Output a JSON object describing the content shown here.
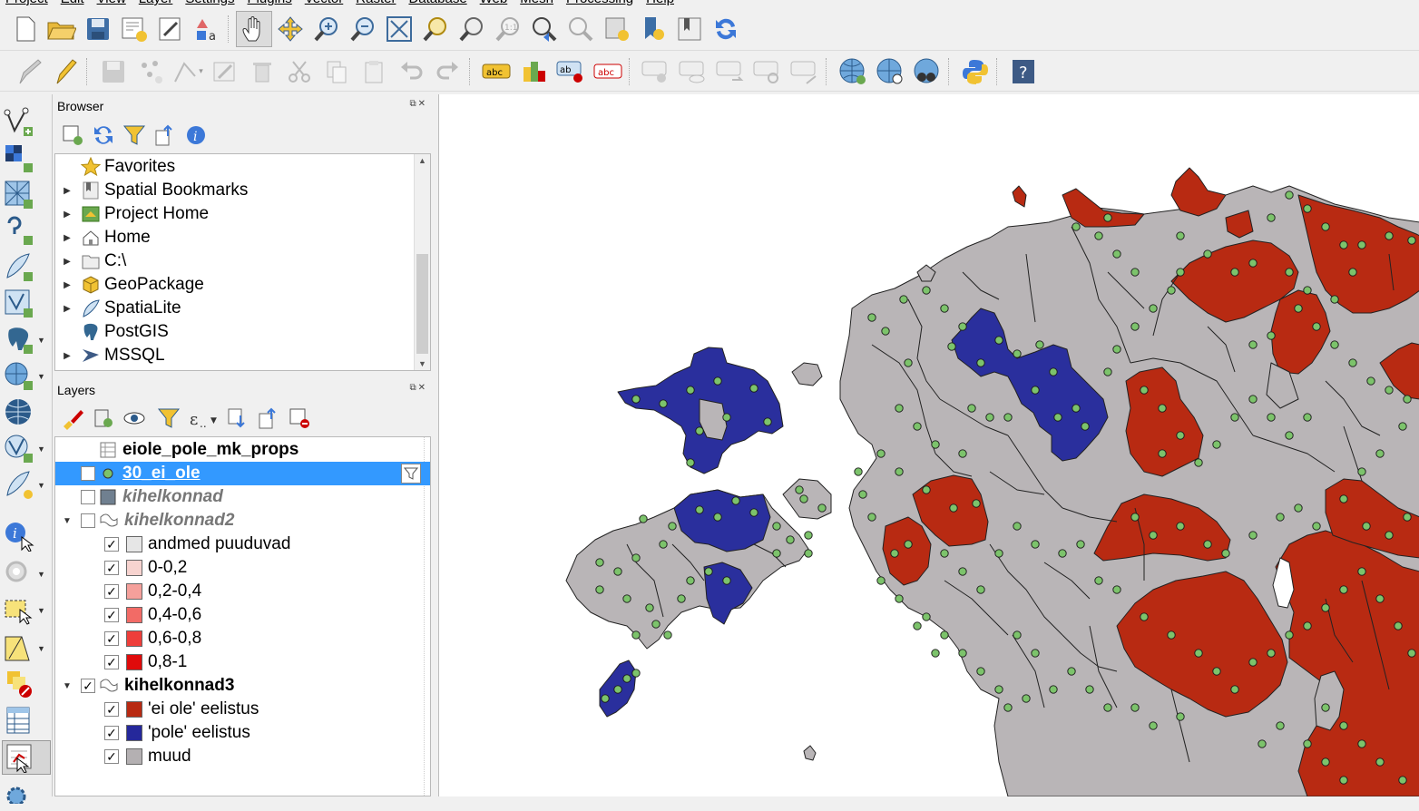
{
  "menu": [
    "Project",
    "Edit",
    "View",
    "Layer",
    "Settings",
    "Plugins",
    "Vector",
    "Raster",
    "Database",
    "Web",
    "Mesh",
    "Processing",
    "Help"
  ],
  "toolbar1": [
    "new-project-icon",
    "open-project-icon",
    "save-project-icon",
    "new-print-layout-icon",
    "style-manager-icon",
    "layout-manager-icon",
    "pan-icon",
    "pan-to-selection-icon",
    "zoom-in-icon",
    "zoom-out-icon",
    "zoom-full-icon",
    "zoom-to-selection-icon",
    "zoom-to-layer-icon",
    "zoom-native-icon",
    "zoom-last-icon",
    "zoom-next-icon",
    "new-map-view-icon",
    "new-bookmark-icon",
    "show-bookmarks-icon",
    "refresh-icon"
  ],
  "toolbar2": [
    "digitize-icon",
    "toggle-editing-icon",
    "save-edits-icon",
    "add-feature-icon",
    "vertex-tool-icon",
    "modify-attributes-icon",
    "delete-selected-icon",
    "cut-features-icon",
    "copy-features-icon",
    "paste-features-icon",
    "undo-icon",
    "redo-icon",
    "label-tool-icon",
    "diagram-tool-icon",
    "pin-labels-icon",
    "highlight-labels-icon",
    "show-hide-labels-icon",
    "move-label-icon",
    "rotate-label-icon",
    "change-label-icon",
    "unpinned-labels-icon",
    "metasearch-icon",
    "georeferencer-icon",
    "osm-search-icon",
    "python-console-icon",
    "help-icon"
  ],
  "browser": {
    "title": "Browser",
    "items": [
      {
        "label": "Favorites",
        "icon": "star-icon",
        "expand": false
      },
      {
        "label": "Spatial Bookmarks",
        "icon": "bookmark-icon",
        "expand": true
      },
      {
        "label": "Project Home",
        "icon": "project-home-icon",
        "expand": true
      },
      {
        "label": "Home",
        "icon": "home-icon",
        "expand": true
      },
      {
        "label": "C:\\",
        "icon": "folder-icon",
        "expand": true
      },
      {
        "label": "GeoPackage",
        "icon": "geopackage-icon",
        "expand": true
      },
      {
        "label": "SpatiaLite",
        "icon": "spatialite-icon",
        "expand": true
      },
      {
        "label": "PostGIS",
        "icon": "postgis-icon",
        "expand": false
      },
      {
        "label": "MSSQL",
        "icon": "mssql-icon",
        "expand": true
      }
    ]
  },
  "layers": {
    "title": "Layers",
    "rows": [
      {
        "label": "eiole_pole_mk_props",
        "bold": true,
        "italic": false,
        "indent": 0,
        "expand": false,
        "check": null,
        "icon": "table-icon"
      },
      {
        "label": "30_ei_ole",
        "bold": true,
        "italic": false,
        "indent": 0,
        "expand": false,
        "check": true,
        "icon": "point-icon",
        "selected": true
      },
      {
        "label": "kihelkonnad",
        "bold": true,
        "italic": true,
        "indent": 0,
        "expand": false,
        "check": false,
        "icon": "raster-icon"
      },
      {
        "label": "kihelkonnad2",
        "bold": true,
        "italic": true,
        "indent": 0,
        "expand": true,
        "check": false,
        "icon": "polygon-icon"
      },
      {
        "label": "andmed puuduvad",
        "indent": 1,
        "check": true,
        "swatch": "#e6e6e6"
      },
      {
        "label": "0-0,2",
        "indent": 1,
        "check": true,
        "swatch": "#f7d3cf"
      },
      {
        "label": "0,2-0,4",
        "indent": 1,
        "check": true,
        "swatch": "#f5a09b"
      },
      {
        "label": "0,4-0,6",
        "indent": 1,
        "check": true,
        "swatch": "#f26b66"
      },
      {
        "label": "0,6-0,8",
        "indent": 1,
        "check": true,
        "swatch": "#ee3e3a"
      },
      {
        "label": "0,8-1",
        "indent": 1,
        "check": true,
        "swatch": "#e00b0b"
      },
      {
        "label": "kihelkonnad3",
        "bold": true,
        "italic": false,
        "indent": 0,
        "expand": true,
        "check": true,
        "icon": "polygon-icon"
      },
      {
        "label": "'ei ole' eelistus",
        "indent": 1,
        "check": true,
        "swatch": "#b82a12"
      },
      {
        "label": "'pole' eelistus",
        "indent": 1,
        "check": true,
        "swatch": "#25289b"
      },
      {
        "label": "muud",
        "indent": 1,
        "check": true,
        "swatch": "#b4b0b2"
      }
    ]
  },
  "colors": {
    "ei_ole": "#b82a12",
    "pole": "#2a2f9d",
    "muud": "#b9b5b7",
    "point": "#7cc36b",
    "selection": "#3399ff"
  }
}
